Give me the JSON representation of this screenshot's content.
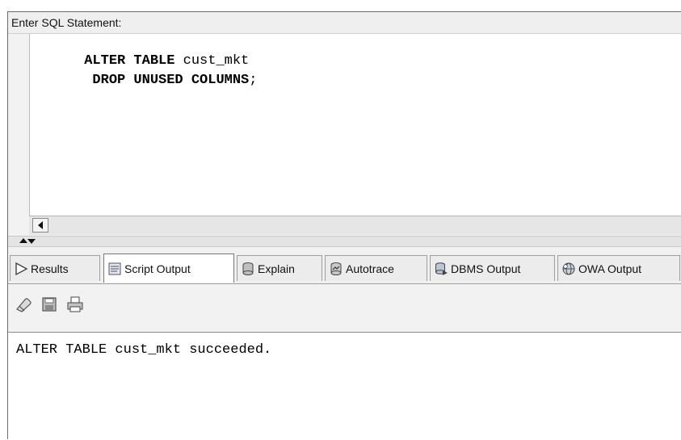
{
  "editor": {
    "label": "Enter SQL Statement:",
    "lines": [
      {
        "kw1": "ALTER TABLE",
        "rest": " cust_mkt"
      },
      {
        "kw1": " DROP UNUSED COLUMNS",
        "rest": ";"
      }
    ]
  },
  "tabs": [
    {
      "label": "Results",
      "icon": "play-icon"
    },
    {
      "label": "Script Output",
      "icon": "script-icon"
    },
    {
      "label": "Explain",
      "icon": "explain-icon"
    },
    {
      "label": "Autotrace",
      "icon": "autotrace-icon"
    },
    {
      "label": "DBMS Output",
      "icon": "dbms-icon"
    },
    {
      "label": "OWA Output",
      "icon": "owa-icon"
    }
  ],
  "active_tab": "Script Output",
  "toolbar": {
    "icons": [
      "eraser-icon",
      "save-icon",
      "print-icon"
    ]
  },
  "output": {
    "text": "ALTER TABLE cust_mkt succeeded."
  }
}
